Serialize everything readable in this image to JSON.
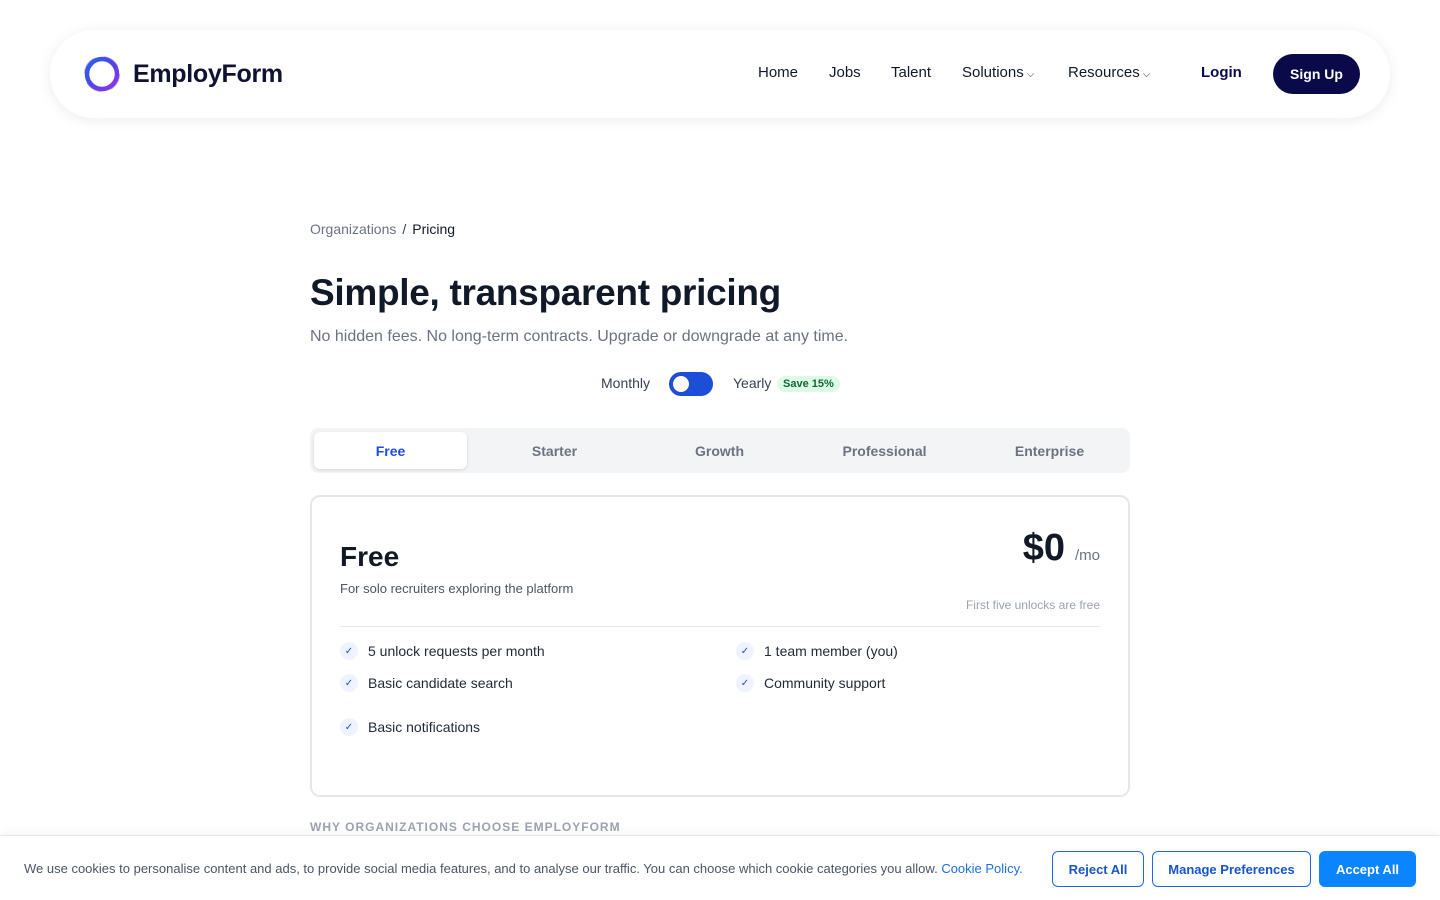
{
  "brand": {
    "name": "EmployForm"
  },
  "nav": {
    "items": [
      {
        "label": "Home"
      },
      {
        "label": "Jobs"
      },
      {
        "label": "Talent"
      },
      {
        "label": "Solutions"
      },
      {
        "label": "Resources"
      }
    ],
    "login_label": "Login",
    "signup_label": "Sign Up"
  },
  "breadcrumb": {
    "parent": "Organizations",
    "separator": "/",
    "current": "Pricing"
  },
  "hero": {
    "title": "Simple, transparent pricing",
    "subtitle": "No hidden fees. No long-term contracts. Upgrade or downgrade at any time."
  },
  "billing": {
    "monthly_label": "Monthly",
    "yearly_label": "Yearly",
    "save_badge": "Save 15%"
  },
  "tabs": [
    {
      "label": "Free"
    },
    {
      "label": "Starter"
    },
    {
      "label": "Growth"
    },
    {
      "label": "Professional"
    },
    {
      "label": "Enterprise"
    }
  ],
  "plan": {
    "name": "Free",
    "description": "For solo recruiters exploring the platform",
    "price": "$0",
    "price_unit": "/mo",
    "price_note": "First five unlocks are free",
    "features": [
      "5 unlock requests per month",
      "1 team member (you)",
      "Basic candidate search",
      "Community support",
      "Basic notifications"
    ]
  },
  "why_heading": "WHY ORGANIZATIONS CHOOSE EMPLOYFORM",
  "cookie": {
    "text": "We use cookies to personalise content and ads, to provide social media features, and to analyse our traffic. You can choose which cookie categories you allow.",
    "link": "Cookie Policy.",
    "reject_label": "Reject All",
    "manage_label": "Manage Preferences",
    "accept_label": "Accept All"
  },
  "colors": {
    "brand_navy": "#0a0a4a",
    "accent_blue": "#1d4ed8",
    "cookie_blue": "#0b84ff",
    "save_green": "#166534"
  }
}
